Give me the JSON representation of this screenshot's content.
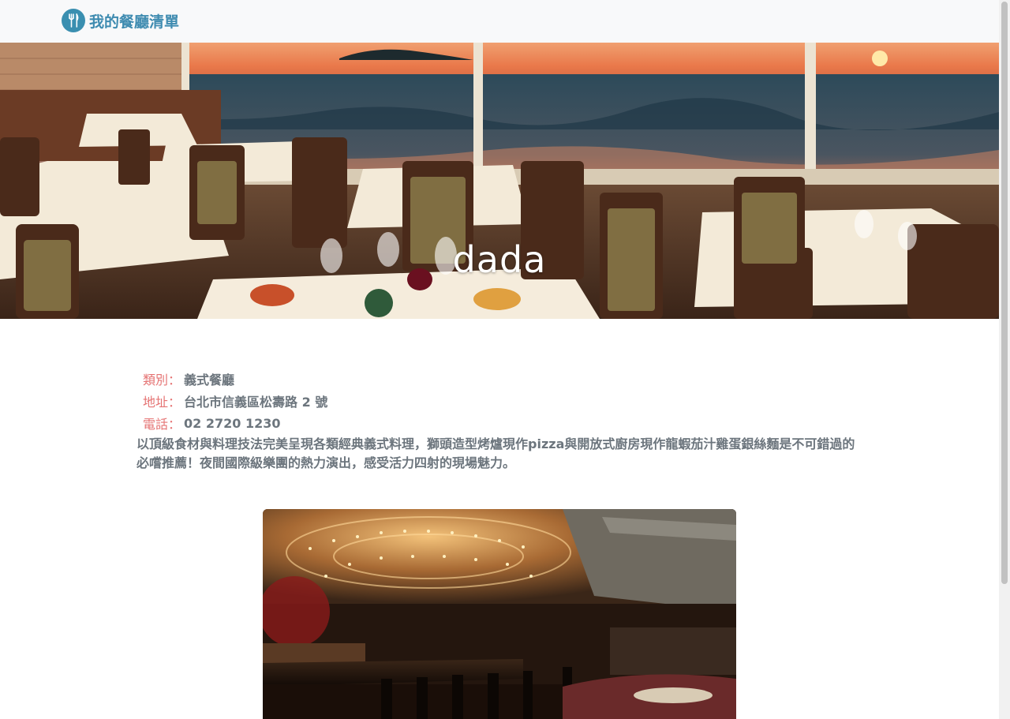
{
  "navbar": {
    "brand_icon": "utensils-icon",
    "brand_text": "我的餐廳清單",
    "brand_color": "#3e8bb0"
  },
  "banner": {
    "title": "dada"
  },
  "info": {
    "category_label": "類別：",
    "category_value": "義式餐廳",
    "address_label": "地址：",
    "address_value": "台北市信義區松壽路 2 號",
    "phone_label": "電話：",
    "phone_value": "02 2720 1230",
    "description": "以頂級食材與料理技法完美呈現各類經典義式料理，獅頭造型烤爐現作pizza與開放式廚房現作龍蝦茄汁雞蛋銀絲麵是不可錯過的必嚐推薦！夜間國際級樂團的熱力演出，感受活力四射的現場魅力。",
    "label_color": "#e57373",
    "text_color": "#6c757d"
  }
}
